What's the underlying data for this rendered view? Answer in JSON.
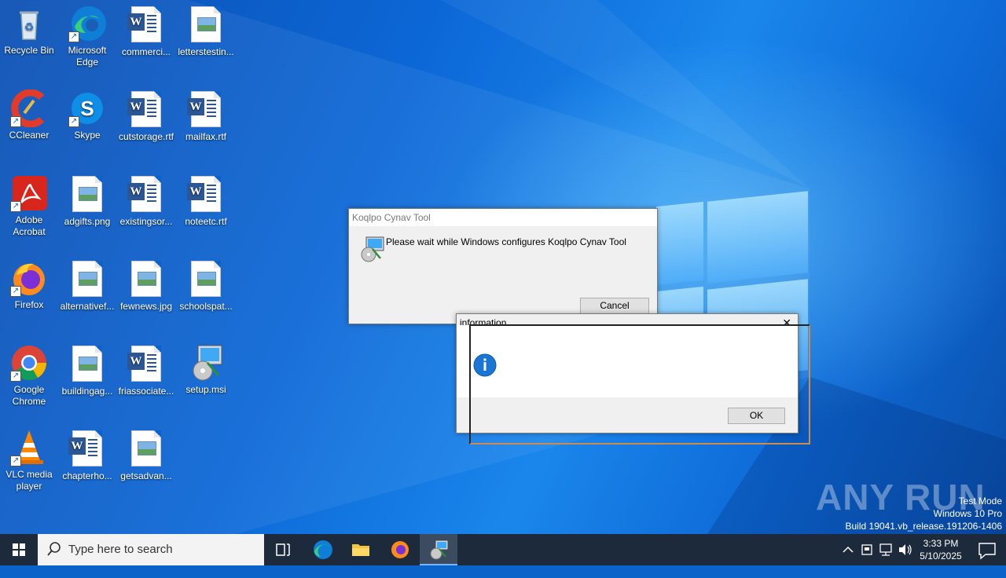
{
  "desktop": {
    "icons": [
      {
        "label": "Recycle Bin"
      },
      {
        "label": "Microsoft Edge"
      },
      {
        "label": "commerci..."
      },
      {
        "label": "letterstestin..."
      },
      {
        "label": "CCleaner"
      },
      {
        "label": "Skype"
      },
      {
        "label": "cutstorage.rtf"
      },
      {
        "label": "mailfax.rtf"
      },
      {
        "label": "Adobe Acrobat"
      },
      {
        "label": "adgifts.png"
      },
      {
        "label": "existingsor..."
      },
      {
        "label": "noteetc.rtf"
      },
      {
        "label": "Firefox"
      },
      {
        "label": "alternativef..."
      },
      {
        "label": "fewnews.jpg"
      },
      {
        "label": "schoolspat..."
      },
      {
        "label": "Google Chrome"
      },
      {
        "label": "buildingag..."
      },
      {
        "label": "friassociate..."
      },
      {
        "label": "setup.msi"
      },
      {
        "label": "VLC media player"
      },
      {
        "label": "chapterho..."
      },
      {
        "label": "getsadvan..."
      }
    ]
  },
  "installer_dialog": {
    "title": "Koqlpo Cynav Tool",
    "message": "Please wait while Windows configures Koqlpo Cynav Tool",
    "cancel_label": "Cancel"
  },
  "info_dialog": {
    "title": "information",
    "close_glyph": "✕",
    "ok_label": "OK"
  },
  "taskbar": {
    "search_placeholder": "Type here to search",
    "time": "3:33 PM",
    "date": "5/10/2025"
  },
  "watermark": {
    "brand": "ANY RUN",
    "line1": "Test Mode",
    "line2": "Windows 10 Pro",
    "line3": "Build 19041.vb_release.191206-1406"
  },
  "colors": {
    "desktop_blue": "#0c67d6",
    "taskbar": "#1c2a3c",
    "info_icon": "#1976d2",
    "focus_outline": "#d08a4a"
  }
}
